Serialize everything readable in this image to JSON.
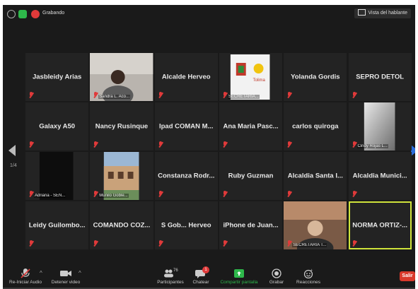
{
  "topbar": {
    "recording_label": "Grabando",
    "speaker_view_label": "Vista del hablante"
  },
  "tiles": [
    {
      "name": "Jasbleidy Arias",
      "label": "",
      "type": "name"
    },
    {
      "name": "",
      "label": "Sandra L. Aco...",
      "type": "video-person"
    },
    {
      "name": "Alcalde Herveo",
      "label": "",
      "type": "name"
    },
    {
      "name": "",
      "label": "SECRETARÍA...",
      "type": "video-logo"
    },
    {
      "name": "Yolanda Gordis",
      "label": "",
      "type": "name"
    },
    {
      "name": "SEPRO DETOL",
      "label": "",
      "type": "name"
    },
    {
      "name": "Galaxy A50",
      "label": "",
      "type": "name"
    },
    {
      "name": "Nancy Rusinque",
      "label": "",
      "type": "name"
    },
    {
      "name": "Ipad COMAN M...",
      "label": "",
      "type": "name"
    },
    {
      "name": "Ana Maria Pasc...",
      "label": "",
      "type": "name"
    },
    {
      "name": "carlos quiroga",
      "label": "",
      "type": "name"
    },
    {
      "name": "",
      "label": "Cindy Rojas L...",
      "type": "video-gray"
    },
    {
      "name": "",
      "label": "Adriana - SEN...",
      "type": "video-dark"
    },
    {
      "name": "",
      "label": "Munilo Goble...",
      "type": "video-building"
    },
    {
      "name": "Constanza Rodr...",
      "label": "",
      "type": "name"
    },
    {
      "name": "Ruby Guzman",
      "label": "",
      "type": "name"
    },
    {
      "name": "Alcaldia Santa I...",
      "label": "",
      "type": "name"
    },
    {
      "name": "Alcaldia Munici...",
      "label": "",
      "type": "name"
    },
    {
      "name": "Leidy Guilombo...",
      "label": "",
      "type": "name"
    },
    {
      "name": "COMANDO COZ...",
      "label": "",
      "type": "name"
    },
    {
      "name": "S Gob... Herveo",
      "label": "",
      "type": "name"
    },
    {
      "name": "iPhone de Juan...",
      "label": "",
      "type": "name"
    },
    {
      "name": "",
      "label": "SECRETARIA T...",
      "type": "video-person2"
    },
    {
      "name": "NORMA ORTIZ-...",
      "label": "",
      "type": "name",
      "active": true
    }
  ],
  "pager": "1/4",
  "toolbar": {
    "audio": "Re-Iniciar Audio",
    "video": "Detener video",
    "participants": "Participantes",
    "participants_count": "76",
    "chat": "Chatear",
    "chat_badge": "1",
    "share": "Compartir pantalla",
    "record": "Grabar",
    "reactions": "Reacciones",
    "leave": "Salir"
  },
  "colors": {
    "background": "#1a1a1a",
    "tile": "#232323",
    "active_outline": "#cfe33b",
    "share_green": "#2eb84b",
    "leave_red": "#d9392b",
    "mic_muted": "#e03a3a"
  }
}
